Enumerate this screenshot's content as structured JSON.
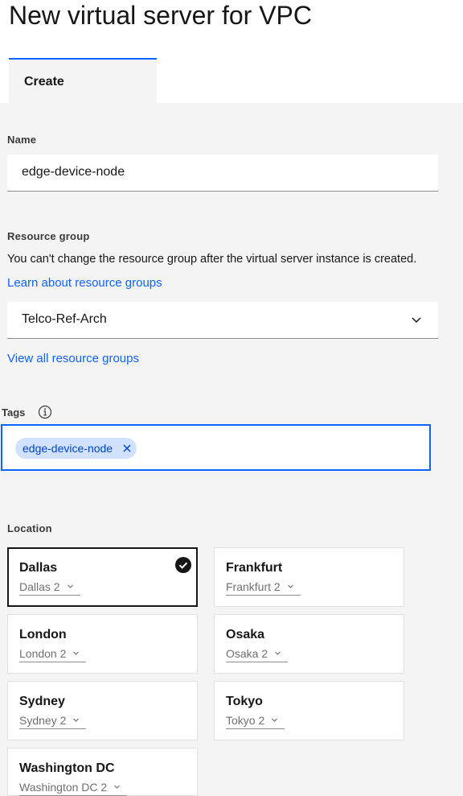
{
  "header": {
    "title": "New virtual server for VPC",
    "tabs": [
      {
        "label": "Create"
      }
    ]
  },
  "name": {
    "label": "Name",
    "value": "edge-device-node"
  },
  "resource_group": {
    "label": "Resource group",
    "helper": "You can't change the resource group after the virtual server instance is created.",
    "learn_link": "Learn about resource groups",
    "selected": "Telco-Ref-Arch",
    "view_all_link": "View all resource groups"
  },
  "tags": {
    "label": "Tags",
    "info_icon": "information-icon",
    "items": [
      {
        "label": "edge-device-node"
      }
    ]
  },
  "location": {
    "label": "Location",
    "selected": "Dallas",
    "tiles": [
      {
        "city": "Dallas",
        "zone": "Dallas 2"
      },
      {
        "city": "Frankfurt",
        "zone": "Frankfurt 2"
      },
      {
        "city": "London",
        "zone": "London 2"
      },
      {
        "city": "Osaka",
        "zone": "Osaka 2"
      },
      {
        "city": "Sydney",
        "zone": "Sydney 2"
      },
      {
        "city": "Tokyo",
        "zone": "Tokyo 2"
      },
      {
        "city": "Washington DC",
        "zone": "Washington DC 2"
      }
    ]
  },
  "colors": {
    "accent": "#0f62fe",
    "tag_bg": "#d0e2ff",
    "background": "#f4f4f4"
  }
}
